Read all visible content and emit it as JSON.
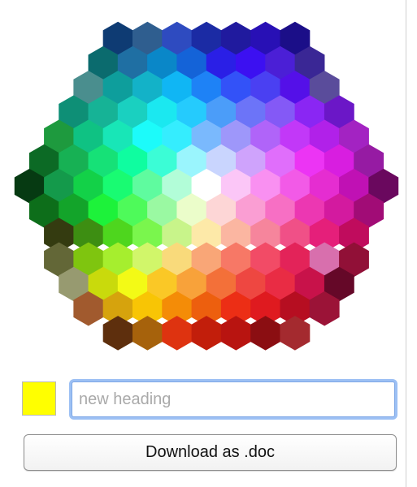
{
  "palette": {
    "rows": [
      [
        "#0E3B73",
        "#2F5E8F",
        "#2E4BC0",
        "#1B2BA4",
        "#201A9E",
        "#2810B5",
        "#1B0E88"
      ],
      [
        "#0B6B6E",
        "#1F6FA3",
        "#0A87C8",
        "#1463D8",
        "#2A1FE6",
        "#3C10F1",
        "#4B1FD6",
        "#3A2795"
      ],
      [
        "#4A8E8E",
        "#0E9E9C",
        "#13B2C8",
        "#10B6F4",
        "#1E82F6",
        "#3352F8",
        "#4A40F2",
        "#5410E8",
        "#5A4C9B"
      ],
      [
        "#0E8F76",
        "#16B396",
        "#1AD0C0",
        "#1BE8F0",
        "#25CBFD",
        "#4B9DF9",
        "#6C74F8",
        "#8459F6",
        "#8A26F3",
        "#6B17C7"
      ],
      [
        "#1E9A3E",
        "#0FC283",
        "#18E6B7",
        "#1CFBFA",
        "#35EDFE",
        "#7AB9FD",
        "#9E97FA",
        "#B064F9",
        "#C238F8",
        "#B121E9",
        "#A323C2"
      ],
      [
        "#0C6A25",
        "#17B154",
        "#16E177",
        "#0FFDA0",
        "#3BFDD6",
        "#9AF5FD",
        "#C9D5FE",
        "#CFA3FC",
        "#E06EFB",
        "#EC34F4",
        "#D81EE0",
        "#961BA3"
      ],
      [
        "#063A12",
        "#149A4B",
        "#13D148",
        "#19FB72",
        "#5FFB9F",
        "#B2FDD8",
        "#FFFFFF",
        "#FBC6F7",
        "#F990F1",
        "#F25AE7",
        "#E52DD1",
        "#C011B4",
        "#6A085E"
      ],
      [
        "#0D6E1A",
        "#13A42A",
        "#1DF23A",
        "#4EFA5A",
        "#9AF9A2",
        "#EBFDCA",
        "#FDD6D6",
        "#FA9ED3",
        "#F76FC4",
        "#EC37B2",
        "#D31A9F",
        "#A10C76"
      ],
      [
        "#343B10",
        "#3D8E12",
        "#4ED61E",
        "#7AF64D",
        "#C8F48A",
        "#FDE9A8",
        "#FBB6A1",
        "#F6859C",
        "#F05087",
        "#E51F7A",
        "#C00C5D"
      ],
      [
        "#636737",
        "#7FC50F",
        "#A6EE2E",
        "#D1F66A",
        "#F9DA7B",
        "#F9A677",
        "#F77866",
        "#F24B66",
        "#E32359",
        "#D86FAD",
        "#911037"
      ],
      [
        "#979A70",
        "#C9DA0C",
        "#F3FA16",
        "#FAC826",
        "#F8A23A",
        "#F37039",
        "#EE4741",
        "#E92C44",
        "#C8124A",
        "#650828"
      ],
      [
        "#A15A2E",
        "#D6A30D",
        "#F8C505",
        "#F48C07",
        "#ED5F0E",
        "#EC2E15",
        "#DF1A1F",
        "#B60E21",
        "#9B1337"
      ],
      [
        "#5E2F0D",
        "#A6620C",
        "#DE3310",
        "#C21E0B",
        "#B81410",
        "#8B0E12",
        "#A42A2F"
      ]
    ],
    "selected_color": "#FFFF00"
  },
  "heading_input": {
    "value": "",
    "placeholder": "new heading"
  },
  "download_button": {
    "label": "Download as .doc"
  }
}
